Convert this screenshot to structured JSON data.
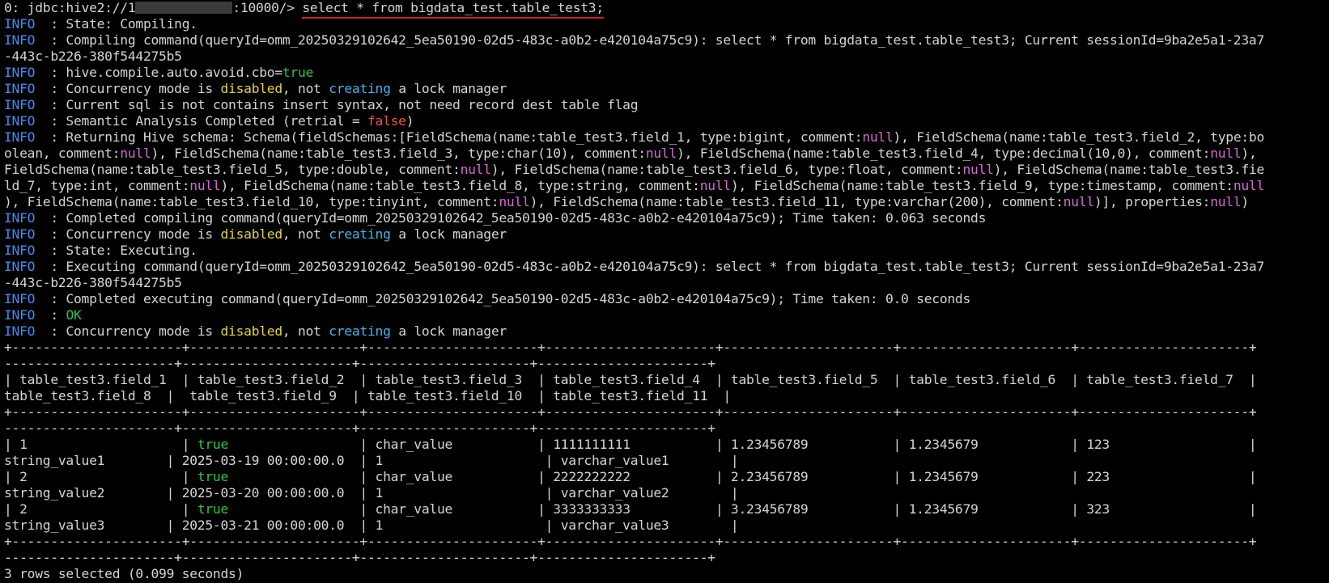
{
  "prompt": {
    "prefix": "0: jdbc:hive2://1",
    "port": ":10000/> ",
    "command": "select * from bigdata_test.table_test3;"
  },
  "logs": [
    {
      "level": "INFO",
      "parts": [
        {
          "t": "  : State: Compiling."
        }
      ]
    },
    {
      "level": "INFO",
      "parts": [
        {
          "t": "  : Compiling command(queryId=omm_20250329102642_5ea50190-02d5-483c-a0b2-e420104a75c9): select * from bigdata_test.table_test3; Current sessionId=9ba2e5a1-23a7"
        }
      ]
    },
    {
      "level": "",
      "parts": [
        {
          "t": "-443c-b226-380f544275b5"
        }
      ]
    },
    {
      "level": "INFO",
      "parts": [
        {
          "t": "  : hive.compile.auto.avoid.cbo="
        },
        {
          "t": "true",
          "c": "kw-g"
        }
      ]
    },
    {
      "level": "INFO",
      "parts": [
        {
          "t": "  : Concurrency mode is "
        },
        {
          "t": "disabled",
          "c": "kw-y"
        },
        {
          "t": ", not "
        },
        {
          "t": "creating",
          "c": "kw-c"
        },
        {
          "t": " a lock manager"
        }
      ]
    },
    {
      "level": "INFO",
      "parts": [
        {
          "t": "  : Current sql is not contains insert syntax, not need record dest table flag"
        }
      ]
    },
    {
      "level": "INFO",
      "parts": [
        {
          "t": "  : Semantic Analysis Completed (retrial = "
        },
        {
          "t": "false",
          "c": "kw-r"
        },
        {
          "t": ")"
        }
      ]
    },
    {
      "level": "INFO",
      "parts": [
        {
          "t": "  : Returning Hive schema: Schema(fieldSchemas:[FieldSchema(name:table_test3.field_1, type:bigint, comment:"
        },
        {
          "t": "null",
          "c": "kw-m"
        },
        {
          "t": "), FieldSchema(name:table_test3.field_2, type:bo"
        }
      ]
    },
    {
      "level": "",
      "parts": [
        {
          "t": "olean, comment:"
        },
        {
          "t": "null",
          "c": "kw-m"
        },
        {
          "t": "), FieldSchema(name:table_test3.field_3, type:char(10), comment:"
        },
        {
          "t": "null",
          "c": "kw-m"
        },
        {
          "t": "), FieldSchema(name:table_test3.field_4, type:decimal(10,0), comment:"
        },
        {
          "t": "null",
          "c": "kw-m"
        },
        {
          "t": "),"
        }
      ]
    },
    {
      "level": "",
      "parts": [
        {
          "t": "FieldSchema(name:table_test3.field_5, type:double, comment:"
        },
        {
          "t": "null",
          "c": "kw-m"
        },
        {
          "t": "), FieldSchema(name:table_test3.field_6, type:float, comment:"
        },
        {
          "t": "null",
          "c": "kw-m"
        },
        {
          "t": "), FieldSchema(name:table_test3.fie"
        }
      ]
    },
    {
      "level": "",
      "parts": [
        {
          "t": "ld_7, type:int, comment:"
        },
        {
          "t": "null",
          "c": "kw-m"
        },
        {
          "t": "), FieldSchema(name:table_test3.field_8, type:string, comment:"
        },
        {
          "t": "null",
          "c": "kw-m"
        },
        {
          "t": "), FieldSchema(name:table_test3.field_9, type:timestamp, comment:"
        },
        {
          "t": "null",
          "c": "kw-m"
        }
      ]
    },
    {
      "level": "",
      "parts": [
        {
          "t": "), FieldSchema(name:table_test3.field_10, type:tinyint, comment:"
        },
        {
          "t": "null",
          "c": "kw-m"
        },
        {
          "t": "), FieldSchema(name:table_test3.field_11, type:varchar(200), comment:"
        },
        {
          "t": "null",
          "c": "kw-m"
        },
        {
          "t": ")], properties:"
        },
        {
          "t": "null",
          "c": "kw-m"
        },
        {
          "t": ")"
        }
      ]
    },
    {
      "level": "INFO",
      "parts": [
        {
          "t": "  : Completed compiling command(queryId=omm_20250329102642_5ea50190-02d5-483c-a0b2-e420104a75c9); Time taken: 0.063 seconds"
        }
      ]
    },
    {
      "level": "INFO",
      "parts": [
        {
          "t": "  : Concurrency mode is "
        },
        {
          "t": "disabled",
          "c": "kw-y"
        },
        {
          "t": ", not "
        },
        {
          "t": "creating",
          "c": "kw-c"
        },
        {
          "t": " a lock manager"
        }
      ]
    },
    {
      "level": "INFO",
      "parts": [
        {
          "t": "  : State: Executing."
        }
      ]
    },
    {
      "level": "INFO",
      "parts": [
        {
          "t": "  : Executing command(queryId=omm_20250329102642_5ea50190-02d5-483c-a0b2-e420104a75c9): select * from bigdata_test.table_test3; Current sessionId=9ba2e5a1-23a7"
        }
      ]
    },
    {
      "level": "",
      "parts": [
        {
          "t": "-443c-b226-380f544275b5"
        }
      ]
    },
    {
      "level": "INFO",
      "parts": [
        {
          "t": "  : Completed executing command(queryId=omm_20250329102642_5ea50190-02d5-483c-a0b2-e420104a75c9); Time taken: 0.0 seconds"
        }
      ]
    },
    {
      "level": "INFO",
      "parts": [
        {
          "t": "  : "
        },
        {
          "t": "OK",
          "c": "kw-g"
        }
      ]
    },
    {
      "level": "INFO",
      "parts": [
        {
          "t": "  : Concurrency mode is "
        },
        {
          "t": "disabled",
          "c": "kw-y"
        },
        {
          "t": ", not "
        },
        {
          "t": "creating",
          "c": "kw-c"
        },
        {
          "t": " a lock manager"
        }
      ]
    }
  ],
  "table": {
    "border_line_1": "+----------------------+----------------------+----------------------+----------------------+----------------------+----------------------+----------------------+",
    "border_line_2": "----------------------+----------------------+----------------------+----------------------+",
    "header": [
      "| table_test3.field_1  | table_test3.field_2  | table_test3.field_3  | table_test3.field_4  | table_test3.field_5  | table_test3.field_6  | table_test3.field_7  |",
      "table_test3.field_8  |  table_test3.field_9  | table_test3.field_10  | table_test3.field_11  |"
    ],
    "rows": [
      {
        "line1": [
          {
            "t": "| 1                    | "
          },
          {
            "t": "true",
            "c": "kw-g"
          },
          {
            "t": "                 | char_value           | 1111111111           | 1.23456789           | 1.2345679            | 123                  |"
          }
        ],
        "line2": [
          {
            "t": "string_value1        | 2025-03-19 00:00:00.0  | 1                     | varchar_value1        |"
          }
        ]
      },
      {
        "line1": [
          {
            "t": "| 2                    | "
          },
          {
            "t": "true",
            "c": "kw-g"
          },
          {
            "t": "                 | char_value           | 2222222222           | 2.23456789           | 1.2345679            | 223                  |"
          }
        ],
        "line2": [
          {
            "t": "string_value2        | 2025-03-20 00:00:00.0  | 1                     | varchar_value2        |"
          }
        ]
      },
      {
        "line1": [
          {
            "t": "| 2                    | "
          },
          {
            "t": "true",
            "c": "kw-g"
          },
          {
            "t": "                 | char_value           | 3333333333           | 3.23456789           | 1.2345679            | 323                  |"
          }
        ],
        "line2": [
          {
            "t": "string_value3        | 2025-03-21 00:00:00.0  | 1                     | varchar_value3        |"
          }
        ]
      }
    ]
  },
  "footer": "3 rows selected (0.099 seconds)",
  "colors": {
    "info": "#3f8ef0",
    "keyword_yellow": "#e5d23a",
    "keyword_cyan": "#3fb5ee",
    "keyword_magenta": "#d36bd2",
    "keyword_red": "#f0524a",
    "keyword_green": "#29c548",
    "underline": "#d1202a"
  }
}
